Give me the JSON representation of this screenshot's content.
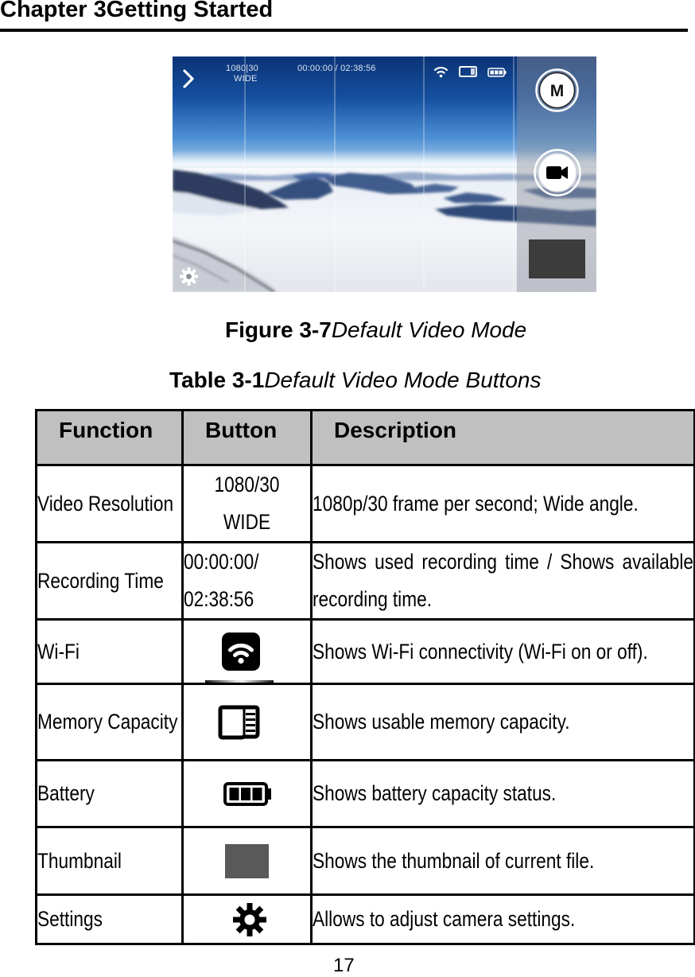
{
  "header": {
    "chapter_title": "Chapter 3Getting Started"
  },
  "figure": {
    "label": "Figure 3-7",
    "title": "Default Video Mode",
    "screen": {
      "resolution_line1": "1080|30",
      "resolution_line2": "WIDE",
      "recording_time": "00:00:00 / 02:38:56",
      "mode_button_label": "M",
      "icons": [
        "chevron-right",
        "wifi",
        "memory-card",
        "battery",
        "mode",
        "record-video",
        "thumbnail",
        "settings"
      ]
    }
  },
  "table": {
    "label": "Table 3-1",
    "title": "Default Video Mode Buttons",
    "columns": [
      "Function",
      "Button",
      "Description"
    ],
    "rows": [
      {
        "function": "Video Resolution",
        "button_lines": [
          "1080/30",
          "WIDE"
        ],
        "description": "1080p/30 frame per second; Wide angle."
      },
      {
        "function": "Recording Time",
        "button_lines": [
          "00:00:00/",
          "02:38:56"
        ],
        "description": "Shows used recording time / Shows available recording time."
      },
      {
        "function": "Wi-Fi",
        "button_icon": "wifi-icon",
        "description": "Shows Wi-Fi connectivity (Wi-Fi on or off)."
      },
      {
        "function": "Memory Capacity",
        "button_icon": "memory-card-icon",
        "description": "Shows usable memory capacity."
      },
      {
        "function": "Battery",
        "button_icon": "battery-icon",
        "description": "Shows battery capacity status."
      },
      {
        "function": "Thumbnail",
        "button_icon": "thumbnail-icon",
        "description": "Shows the thumbnail of current file."
      },
      {
        "function": "Settings",
        "button_icon": "gear-icon",
        "description": "Allows to adjust camera settings."
      }
    ]
  },
  "page_number": "17",
  "colors": {
    "text": "#000000",
    "table_header_bg": "#c0c0c0",
    "thumbnail_gray": "#595959",
    "sky_blue": "#1550a0"
  }
}
